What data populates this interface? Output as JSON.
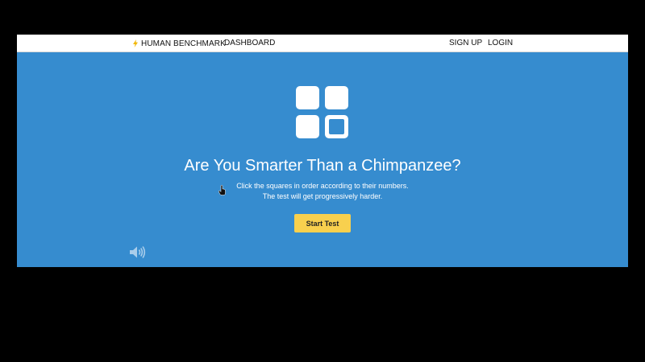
{
  "nav": {
    "brand_label": "HUMAN BENCHMARK",
    "brand_icon": "lightning-bolt-icon",
    "dashboard_label": "DASHBOARD",
    "signup_label": "SIGN UP",
    "login_label": "LOGIN"
  },
  "hero": {
    "logo_icon": "grid-squares-icon",
    "title": "Are You Smarter Than a Chimpanzee?",
    "subtitle_line1": "Click the squares in order according to their numbers.",
    "subtitle_line2": "The test will get progressively harder.",
    "start_button_label": "Start Test",
    "sound_icon": "speaker-icon"
  },
  "colors": {
    "hero_background": "#368ccf",
    "button": "#f8d04e",
    "nav_background": "#ffffff"
  }
}
